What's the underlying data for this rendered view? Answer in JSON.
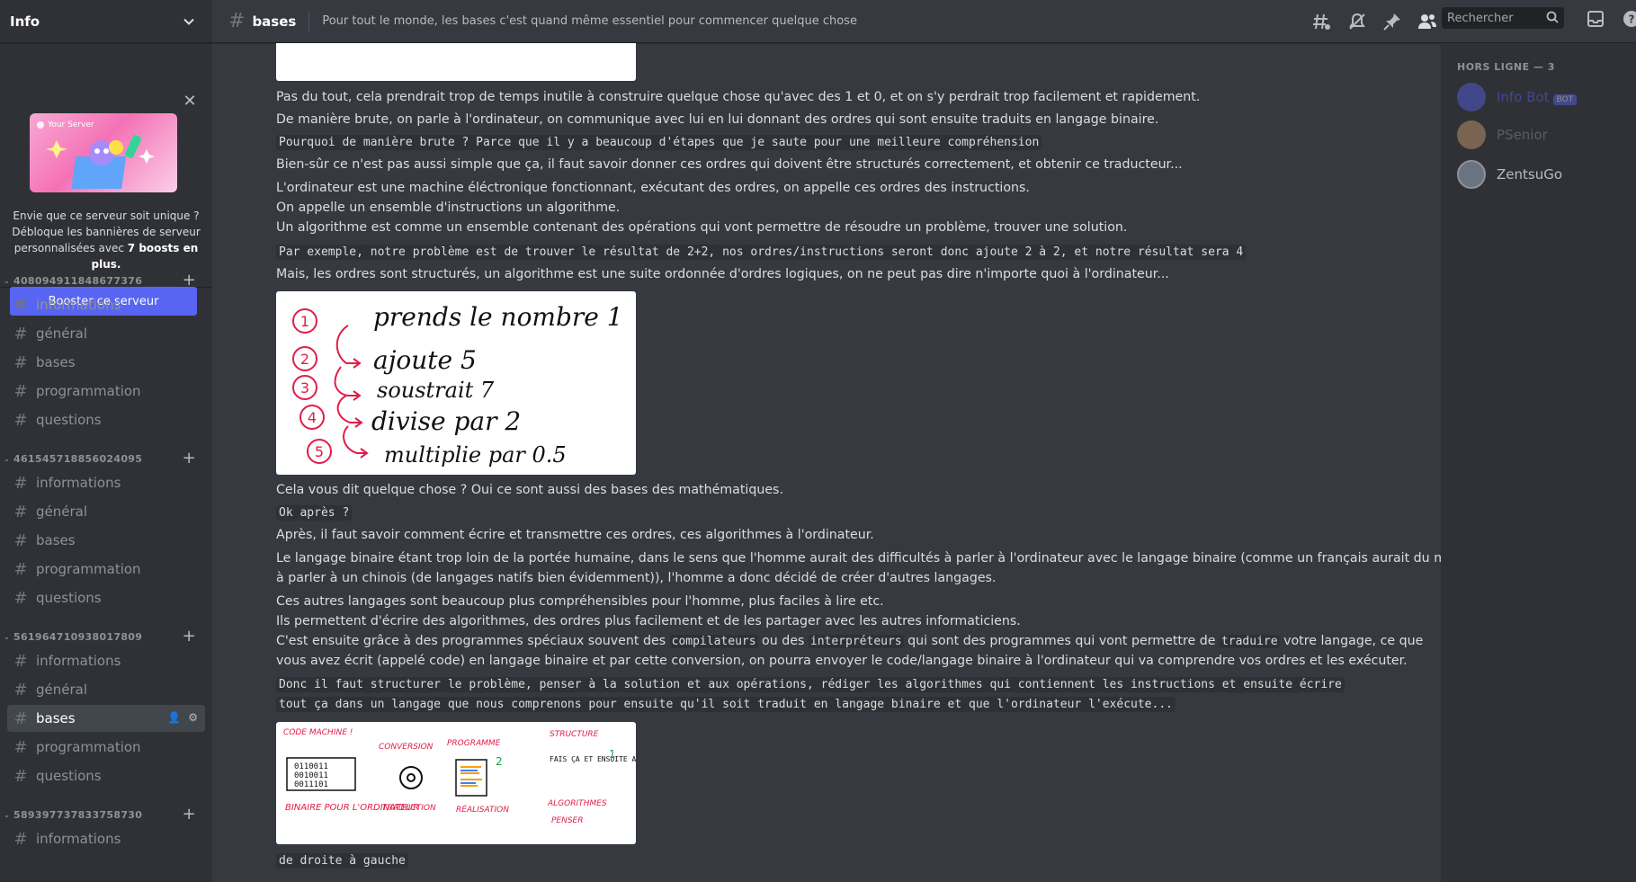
{
  "server": {
    "name": "Info"
  },
  "boost": {
    "banner_label": "Your Server",
    "text_pre": "Envie que ce serveur soit unique ? Débloque les bannières de serveur personnalisées avec ",
    "text_bold": "7 boosts en plus.",
    "button": "Booster ce serveur"
  },
  "categories": [
    {
      "name": "408094911848677376",
      "channels": [
        "informations",
        "général",
        "bases",
        "programmation",
        "questions"
      ]
    },
    {
      "name": "461545718856024095",
      "channels": [
        "informations",
        "général",
        "bases",
        "programmation",
        "questions"
      ]
    },
    {
      "name": "561964710938017809",
      "channels": [
        "informations",
        "général",
        "bases",
        "programmation",
        "questions"
      ]
    },
    {
      "name": "589397737833758730",
      "channels": [
        "informations"
      ]
    }
  ],
  "header": {
    "channel": "bases",
    "topic": "Pour tout le monde, les bases c'est quand même essentiel pour commencer quelque chose",
    "search_placeholder": "Rechercher"
  },
  "messages": {
    "l1": "Pas du tout, cela prendrait trop de temps inutile à construire quelque chose qu'avec des 1 et 0, et on s'y perdrait trop facilement et rapidement.",
    "l2": "De manière brute, on parle à l'ordinateur, on communique avec lui en lui donnant des ordres qui sont ensuite traduits en langage binaire.",
    "l3": "Pourquoi de manière brute ? Parce que il y a beaucoup d'étapes que je saute pour une meilleure compréhension",
    "l4": "Bien-sûr ce n'est pas aussi simple que ça, il faut savoir donner ces ordres qui doivent être structurés correctement, et obtenir ce traducteur...",
    "l5": "L'ordinateur est une machine éléctronique fonctionnant, exécutant des ordres, on appelle ces ordres des instructions.",
    "l6": "On appelle un ensemble d'instructions un algorithme.",
    "l7": "Un algorithme est comme un ensemble contenant des opérations qui vont permettre de résoudre un problème, trouver une solution.",
    "l8": "Par exemple, notre problème est de trouver le résultat de 2+2, nos ordres/instructions seront donc ajoute 2 à 2, et notre résultat sera 4",
    "l9": "Mais, les ordres sont structurés, un algorithme est une suite ordonnée d'ordres logiques, on ne peut pas dire n'importe quoi à l'ordinateur...",
    "img1": [
      "prends le nombre 1",
      "ajoute 5",
      "soustrait 7",
      "divise par 2",
      "multiplie par 0.5"
    ],
    "l10": "Cela vous dit quelque chose ? Oui ce sont aussi des bases des mathématiques.",
    "l11": "Ok après ?",
    "l12": "Après, il faut savoir comment écrire et transmettre ces ordres, ces algorithmes à l'ordinateur.",
    "l13a": "Le langage binaire étant trop loin de la portée humaine, dans le sens que l'homme aurait des difficultés à parler à l'ordinateur avec le langage binaire (comme un français aurait du mal",
    "l13b": "à parler à un chinois (de langages natifs bien évidemment)), l'homme a donc décidé de créer d'autres langages.",
    "l14": "Ces autres langages sont beaucoup plus compréhensibles pour l'homme, plus faciles à lire etc.",
    "l15": "Ils permettent d'écrire des algorithmes, des ordres plus facilement et de les partager avec les autres informaticiens.",
    "l16_pre": "C'est ensuite grâce à des programmes spéciaux souvent des ",
    "l16_c1": "compilateurs",
    "l16_mid": " ou des ",
    "l16_c2": "interpréteurs",
    "l16_mid2": " qui sont des programmes qui vont permettre de ",
    "l16_c3": "traduire",
    "l16_post": " votre langage, ce que",
    "l17": "vous avez écrit (appelé code) en langage binaire et par cette conversion, on pourra envoyer le code/langage binaire à l'ordinateur qui va comprendre vos ordres et les exécuter.",
    "l18a": "Donc il faut structurer le problème, penser à la solution et aux opérations, rédiger les algorithmes qui contiennent les instructions et ensuite écrire",
    "l18b": "tout ça dans un langage que nous comprenons pour ensuite qu'il soit traduit en langage binaire et que l'ordinateur l'exécute...",
    "img2": {
      "code_machine": "CODE MACHINE !",
      "binary": [
        "0110011",
        "0010011",
        "0011101"
      ],
      "binaire": "BINAIRE POUR L'ORDINATEUR",
      "conversion": "CONVERSION",
      "traduction": "TRADUCTION",
      "programme": "PROGRAMME",
      "realisation": "RÉALISATION",
      "structure": "STRUCTURE",
      "fais": "FAIS ÇA ET ENSUITE AFFICHE...",
      "algorithmes": "ALGORITHMES",
      "penser": "PENSER",
      "n1": "1",
      "n2": "2"
    },
    "l19": "de droite à gauche"
  },
  "members": {
    "header": "HORS LIGNE — 3",
    "list": [
      {
        "name": "Info Bot",
        "bot": "BOT"
      },
      {
        "name": "PSenior"
      },
      {
        "name": "ZentsuGo"
      }
    ]
  }
}
